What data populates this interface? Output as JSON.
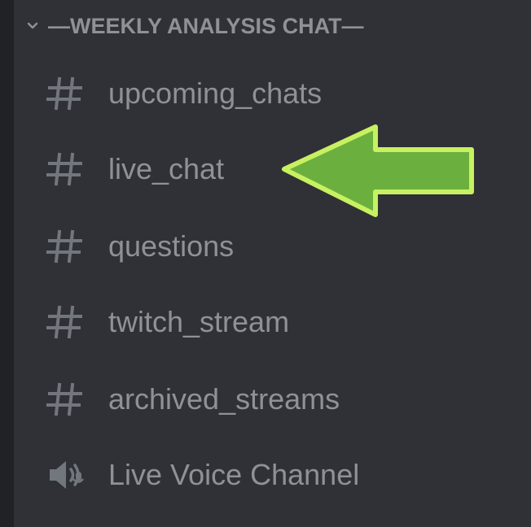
{
  "category": {
    "label": "—WEEKLY ANALYSIS CHAT—",
    "expanded": true,
    "chevron_icon": "chevron-down-icon"
  },
  "channels": [
    {
      "type": "text",
      "icon": "hash-icon",
      "label": "upcoming_chats"
    },
    {
      "type": "text",
      "icon": "hash-icon",
      "label": "live_chat",
      "highlighted": true
    },
    {
      "type": "text",
      "icon": "hash-icon",
      "label": "questions"
    },
    {
      "type": "text",
      "icon": "hash-icon",
      "label": "twitch_stream"
    },
    {
      "type": "text",
      "icon": "hash-icon",
      "label": "archived_streams"
    },
    {
      "type": "voice",
      "icon": "speaker-icon",
      "label": "Live Voice Channel"
    }
  ],
  "annotation": {
    "icon": "arrow-left-icon",
    "fill_color": "#6bb03e",
    "stroke_color": "#c8f060"
  },
  "colors": {
    "background": "#2f3136",
    "text_muted": "#8e9297",
    "icon_muted": "#72767d"
  }
}
